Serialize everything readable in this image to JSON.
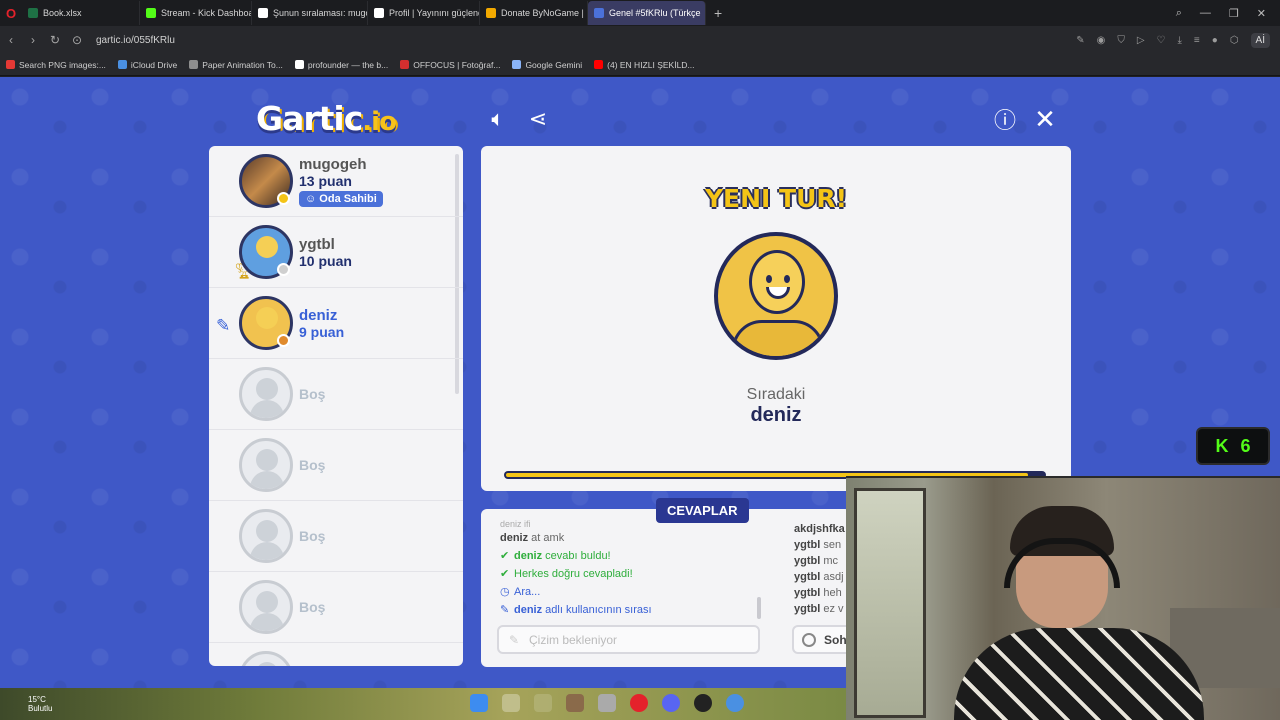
{
  "browser": {
    "tabs": [
      {
        "title": "Book.xlsx",
        "color": "#1e7145"
      },
      {
        "title": "Stream - Kick Dashboard",
        "color": "#53fc18"
      },
      {
        "title": "Şunun sıralaması: mugoge",
        "color": "#ffffff"
      },
      {
        "title": "Profil | Yayınını güçlendirm",
        "color": "#ffffff"
      },
      {
        "title": "Donate ByNoGame | Don",
        "color": "#f2a900"
      },
      {
        "title": "Genel #5fKRlu (Türkçe",
        "color": "#4b71d9"
      }
    ],
    "url": "gartic.io/055fKRlu",
    "ai_label": "Aİ",
    "bookmarks": [
      {
        "label": "Search PNG images:...",
        "color": "#e53935"
      },
      {
        "label": "iCloud Drive",
        "color": "#4a90e2"
      },
      {
        "label": "Paper Animation To...",
        "color": "#8e8e8e"
      },
      {
        "label": "profounder — the b...",
        "color": "#ffffff"
      },
      {
        "label": "OFFOCUS | Fotoğraf...",
        "color": "#d32f2f"
      },
      {
        "label": "Google Gemini",
        "color": "#8ab4f8"
      },
      {
        "label": "(4) EN HIZLI ŞEKİLD...",
        "color": "#ff0000"
      }
    ]
  },
  "game": {
    "logo_main": "Gartic",
    "logo_io": ".io",
    "players": [
      {
        "name": "mugogeh",
        "score": "13 puan",
        "badge": "Oda Sahibi",
        "status_color": "#f4c417",
        "avatar": "photo"
      },
      {
        "name": "ygtbl",
        "score": "10 puan",
        "status_color": "#cfcfcf",
        "avatar": "granny"
      },
      {
        "name": "deniz",
        "score": "9 puan",
        "status_color": "#e08a2c",
        "avatar": "smiley"
      }
    ],
    "empty_label": "Boş",
    "round_title": "YENI TUR!",
    "next_label": "Sıradaki",
    "next_name": "deniz",
    "timer_fraction": 0.97
  },
  "answers": {
    "title": "CEVAPLAR",
    "faded_line": "deniz ifi",
    "lines": [
      {
        "user": "deniz",
        "text": " at amk",
        "kind": "plain"
      },
      {
        "user": "deniz",
        "text": " cevabı buldu!",
        "kind": "green",
        "icon": "✔"
      },
      {
        "user": "",
        "text": "Herkes doğru cevapladi!",
        "kind": "green",
        "icon": "✔"
      },
      {
        "user": "",
        "text": "Ara...",
        "kind": "blue",
        "icon": "◷"
      },
      {
        "user": "deniz",
        "text": " adlı kullanıcının sırası",
        "kind": "blue",
        "icon": "✎"
      }
    ],
    "input_placeholder": "Çizim bekleniyor"
  },
  "chat": {
    "lines": [
      {
        "user": "akdjshfka",
        "text": ""
      },
      {
        "user": "ygtbl",
        "text": " sen"
      },
      {
        "user": "ygtbl",
        "text": " mc"
      },
      {
        "user": "ygtbl",
        "text": " asdj"
      },
      {
        "user": "ygtbl",
        "text": " heh"
      },
      {
        "user": "ygtbl",
        "text": " ez v"
      }
    ],
    "input_label": "Soh"
  },
  "kick_overlay": {
    "letter": "K",
    "count": "6"
  },
  "taskbar": {
    "temp": "15°C",
    "weather": "Bulutlu"
  }
}
